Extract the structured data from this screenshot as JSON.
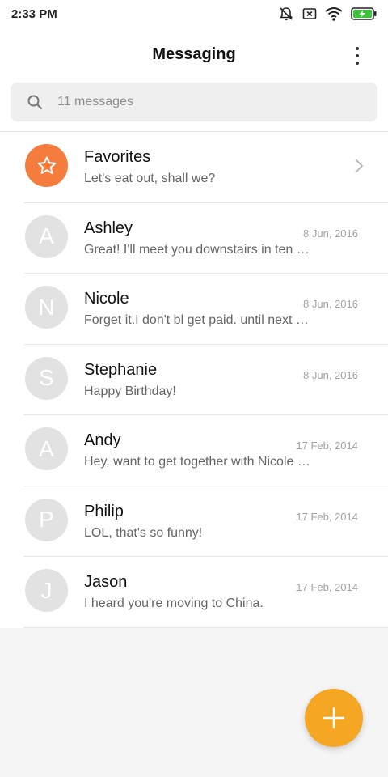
{
  "status_bar": {
    "time": "2:33 PM",
    "icons": [
      "notifications-off-icon",
      "no-sim-icon",
      "wifi-icon",
      "battery-charging-icon"
    ],
    "battery_color": "#3bc43b"
  },
  "header": {
    "title": "Messaging",
    "menu_icon": "more-vertical-icon"
  },
  "search": {
    "placeholder": "11 messages",
    "icon": "search-icon"
  },
  "accent": {
    "favorites": "#f47c3c",
    "fab": "#f5a623"
  },
  "favorites": {
    "name": "Favorites",
    "snippet": "Let's eat out, shall we?",
    "icon": "star-icon",
    "chevron": "chevron-right-icon"
  },
  "conversations": [
    {
      "initial": "A",
      "name": "Ashley",
      "date": "8 Jun, 2016",
      "snippet": "Great! I'll meet you downstairs in ten …"
    },
    {
      "initial": "N",
      "name": "Nicole",
      "date": "8 Jun, 2016",
      "snippet": "Forget it.I don't bl get paid. until next F…"
    },
    {
      "initial": "S",
      "name": "Stephanie",
      "date": "8 Jun, 2016",
      "snippet": "Happy Birthday!"
    },
    {
      "initial": "A",
      "name": "Andy",
      "date": "17 Feb, 2014",
      "snippet": "Hey, want to get together with Nicole …"
    },
    {
      "initial": "P",
      "name": "Philip",
      "date": "17 Feb, 2014",
      "snippet": "LOL, that's so funny!"
    },
    {
      "initial": "J",
      "name": "Jason",
      "date": "17 Feb, 2014",
      "snippet": "I heard you're moving to China."
    }
  ],
  "fab": {
    "icon": "plus-icon"
  }
}
